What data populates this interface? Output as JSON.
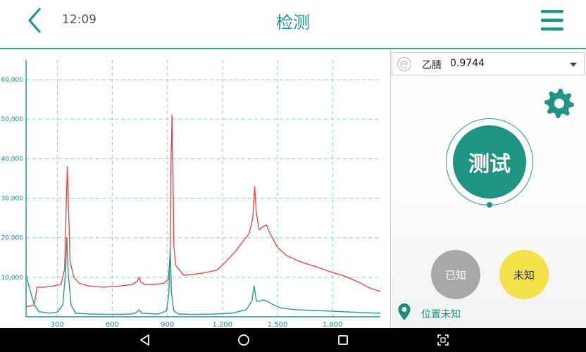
{
  "header": {
    "time": "12:09",
    "title": "检测",
    "back_icon": "chevron-left-icon",
    "menu_icon": "hamburger-menu-icon",
    "accent_color": "#1a9a88"
  },
  "chart_data": {
    "type": "line",
    "x_ticks": [
      "300",
      "600",
      "900",
      "1,200",
      "1,500",
      "1,800"
    ],
    "y_ticks": [
      "10,000",
      "20,000",
      "30,000",
      "40,000",
      "50,000",
      "60,000"
    ],
    "xlim": [
      130,
      2060
    ],
    "ylim": [
      0,
      65000
    ],
    "grid": true,
    "series": [
      {
        "color": "#e84a4a",
        "points": [
          [
            130,
            2500
          ],
          [
            175,
            3000
          ],
          [
            190,
            7500
          ],
          [
            230,
            7500
          ],
          [
            280,
            7800
          ],
          [
            320,
            8200
          ],
          [
            340,
            12000
          ],
          [
            350,
            30000
          ],
          [
            355,
            38000
          ],
          [
            360,
            30000
          ],
          [
            370,
            14000
          ],
          [
            390,
            10000
          ],
          [
            420,
            8500
          ],
          [
            470,
            7800
          ],
          [
            550,
            7500
          ],
          [
            620,
            7700
          ],
          [
            680,
            8000
          ],
          [
            710,
            8200
          ],
          [
            735,
            9000
          ],
          [
            745,
            10000
          ],
          [
            755,
            8800
          ],
          [
            775,
            8200
          ],
          [
            830,
            8200
          ],
          [
            880,
            8500
          ],
          [
            905,
            9500
          ],
          [
            915,
            16000
          ],
          [
            920,
            40000
          ],
          [
            925,
            51000
          ],
          [
            930,
            38000
          ],
          [
            935,
            18000
          ],
          [
            945,
            13000
          ],
          [
            990,
            10500
          ],
          [
            1050,
            10800
          ],
          [
            1110,
            11200
          ],
          [
            1170,
            11800
          ],
          [
            1220,
            14000
          ],
          [
            1270,
            16500
          ],
          [
            1310,
            19000
          ],
          [
            1345,
            21000
          ],
          [
            1365,
            25000
          ],
          [
            1375,
            33000
          ],
          [
            1385,
            26000
          ],
          [
            1400,
            22000
          ],
          [
            1420,
            22800
          ],
          [
            1440,
            23200
          ],
          [
            1460,
            21000
          ],
          [
            1500,
            17500
          ],
          [
            1550,
            15500
          ],
          [
            1620,
            14000
          ],
          [
            1700,
            12800
          ],
          [
            1780,
            11500
          ],
          [
            1870,
            10200
          ],
          [
            1950,
            8600
          ],
          [
            2000,
            7300
          ],
          [
            2060,
            6400
          ]
        ]
      },
      {
        "color": "#2a9a8a",
        "points": [
          [
            130,
            10500
          ],
          [
            150,
            7000
          ],
          [
            175,
            3000
          ],
          [
            200,
            1300
          ],
          [
            260,
            900
          ],
          [
            300,
            1200
          ],
          [
            330,
            3000
          ],
          [
            345,
            11000
          ],
          [
            352,
            20000
          ],
          [
            360,
            11000
          ],
          [
            375,
            3000
          ],
          [
            400,
            900
          ],
          [
            480,
            700
          ],
          [
            600,
            600
          ],
          [
            700,
            700
          ],
          [
            730,
            1000
          ],
          [
            745,
            1800
          ],
          [
            760,
            900
          ],
          [
            850,
            700
          ],
          [
            895,
            1500
          ],
          [
            908,
            6000
          ],
          [
            915,
            17500
          ],
          [
            922,
            6000
          ],
          [
            935,
            1500
          ],
          [
            960,
            700
          ],
          [
            1050,
            600
          ],
          [
            1150,
            700
          ],
          [
            1250,
            900
          ],
          [
            1330,
            1800
          ],
          [
            1360,
            4000
          ],
          [
            1372,
            7800
          ],
          [
            1385,
            4000
          ],
          [
            1400,
            3900
          ],
          [
            1420,
            4300
          ],
          [
            1440,
            4000
          ],
          [
            1470,
            3200
          ],
          [
            1520,
            2200
          ],
          [
            1600,
            1800
          ],
          [
            1700,
            1600
          ],
          [
            1800,
            1400
          ],
          [
            1900,
            1200
          ],
          [
            2000,
            1000
          ],
          [
            2060,
            900
          ]
        ]
      }
    ]
  },
  "panel": {
    "compound_icon": "element-e-icon",
    "compound_name": "乙腈",
    "compound_value": "0.9744",
    "settings_icon": "gear-icon",
    "test_label": "测试",
    "known_label": "已知",
    "unknown_label": "未知",
    "location_icon": "map-pin-icon",
    "location_text": "位置未知",
    "colors": {
      "primary": "#1f9483",
      "known": "#a8a8a8",
      "unknown": "#f3e04a"
    }
  },
  "navbar": {
    "back_icon": "triangle-back-icon",
    "home_icon": "circle-home-icon",
    "recents_icon": "square-recents-icon",
    "screenshot_icon": "scan-frame-icon"
  }
}
